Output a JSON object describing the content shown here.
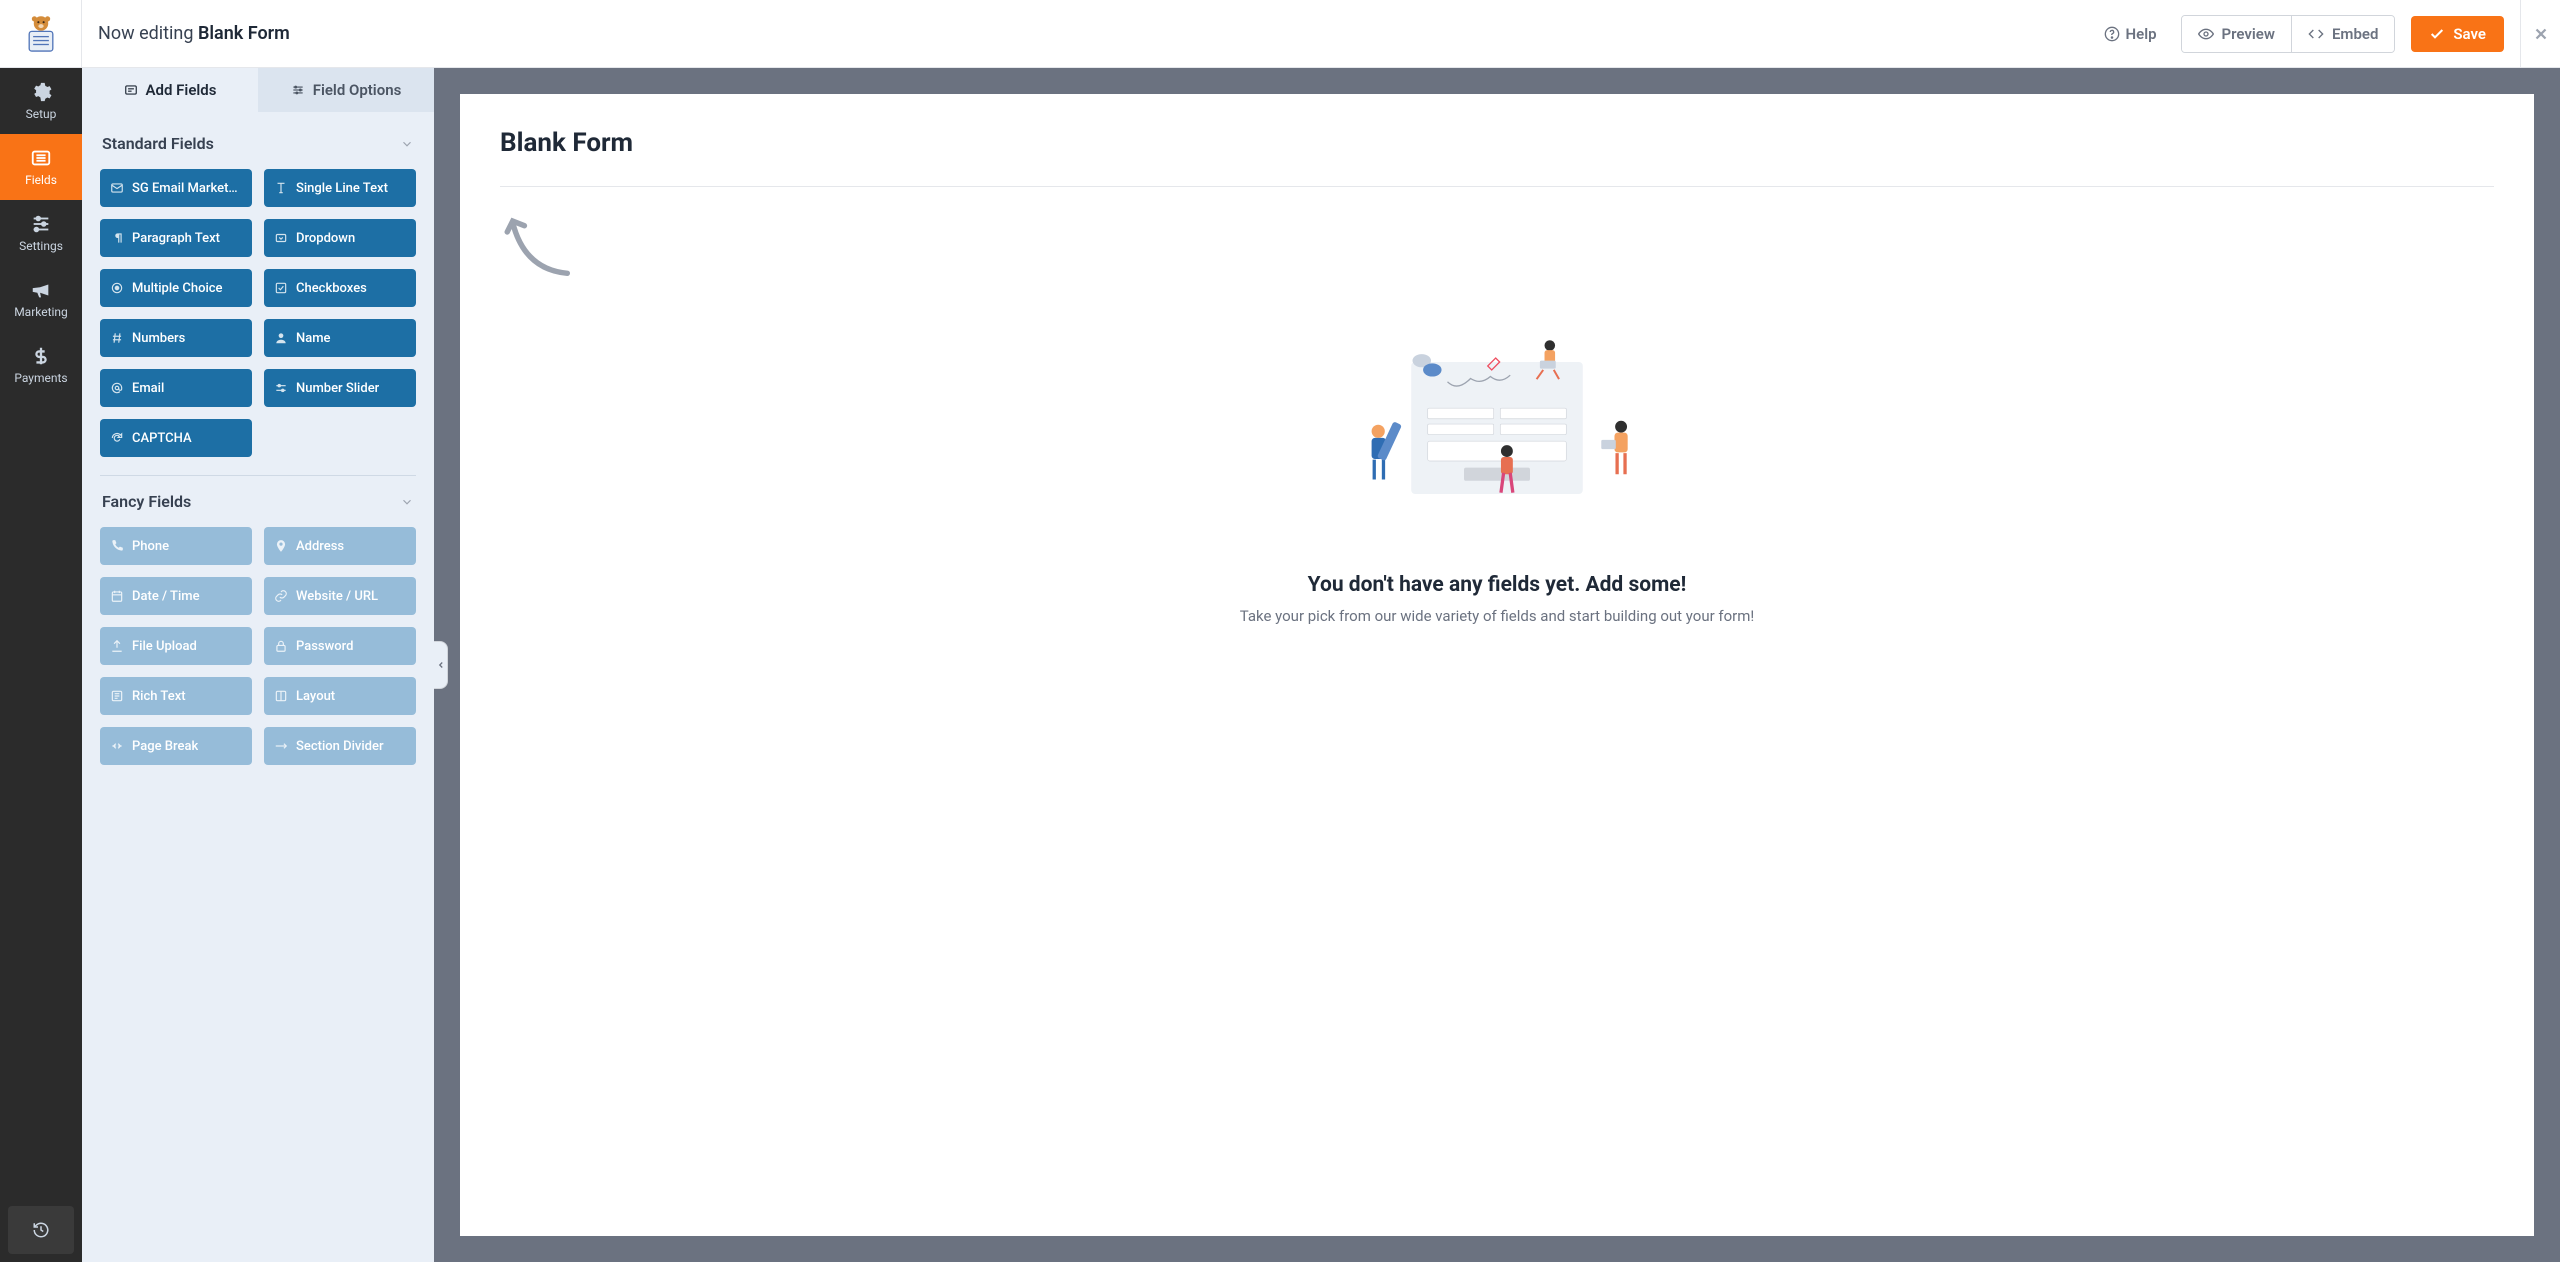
{
  "header": {
    "prefix": "Now editing",
    "form_name": "Blank Form",
    "help": "Help",
    "preview": "Preview",
    "embed": "Embed",
    "save": "Save"
  },
  "leftnav": {
    "setup": "Setup",
    "fields": "Fields",
    "settings": "Settings",
    "marketing": "Marketing",
    "payments": "Payments"
  },
  "panel": {
    "tab_add": "Add Fields",
    "tab_options": "Field Options",
    "sections": {
      "standard": {
        "title": "Standard Fields"
      },
      "fancy": {
        "title": "Fancy Fields"
      }
    },
    "standard_fields": [
      "SG Email Market…",
      "Single Line Text",
      "Paragraph Text",
      "Dropdown",
      "Multiple Choice",
      "Checkboxes",
      "Numbers",
      "Name",
      "Email",
      "Number Slider",
      "CAPTCHA"
    ],
    "fancy_fields": [
      "Phone",
      "Address",
      "Date / Time",
      "Website / URL",
      "File Upload",
      "Password",
      "Rich Text",
      "Layout",
      "Page Break",
      "Section Divider"
    ]
  },
  "canvas": {
    "form_title": "Blank Form",
    "empty_heading": "You don't have any fields yet. Add some!",
    "empty_sub": "Take your pick from our wide variety of fields and start building out your form!"
  }
}
